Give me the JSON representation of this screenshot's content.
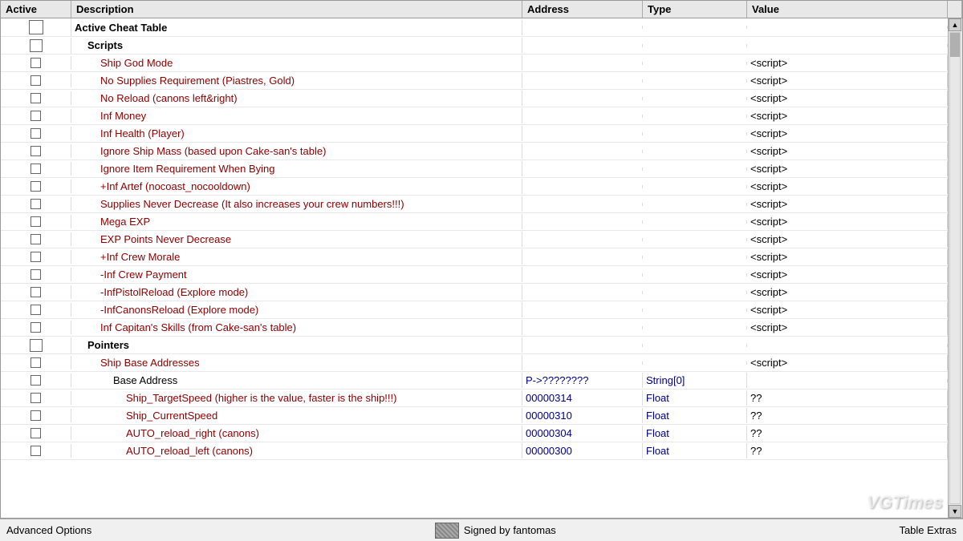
{
  "header": {
    "cols": [
      "Active",
      "Description",
      "Address",
      "Type",
      "Value"
    ]
  },
  "rows": [
    {
      "level": 0,
      "active": true,
      "desc": "Active Cheat Table",
      "address": "",
      "type": "",
      "value": "",
      "hasScript": false,
      "cbSize": "large"
    },
    {
      "level": 1,
      "active": true,
      "desc": "Scripts",
      "address": "",
      "type": "",
      "value": "",
      "hasScript": false,
      "cbSize": "medium"
    },
    {
      "level": 2,
      "active": false,
      "desc": "Ship God Mode",
      "address": "",
      "type": "",
      "value": "<script>",
      "hasScript": true
    },
    {
      "level": 2,
      "active": false,
      "desc": "No Supplies Requirement (Piastres, Gold)",
      "address": "",
      "type": "",
      "value": "<script>",
      "hasScript": true
    },
    {
      "level": 2,
      "active": false,
      "desc": "No Reload (canons left&right)",
      "address": "",
      "type": "",
      "value": "<script>",
      "hasScript": true
    },
    {
      "level": 2,
      "active": false,
      "desc": "Inf Money",
      "address": "",
      "type": "",
      "value": "<script>",
      "hasScript": true
    },
    {
      "level": 2,
      "active": false,
      "desc": "Inf Health (Player)",
      "address": "",
      "type": "",
      "value": "<script>",
      "hasScript": true
    },
    {
      "level": 2,
      "active": false,
      "desc": "Ignore Ship Mass  (based upon Cake-san's table)",
      "address": "",
      "type": "",
      "value": "<script>",
      "hasScript": true
    },
    {
      "level": 2,
      "active": false,
      "desc": "Ignore Item Requirement When Bying",
      "address": "",
      "type": "",
      "value": "<script>",
      "hasScript": true
    },
    {
      "level": 2,
      "active": false,
      "desc": "+Inf Artef (nocoast_nocooldown)",
      "address": "",
      "type": "",
      "value": "<script>",
      "hasScript": true
    },
    {
      "level": 2,
      "active": false,
      "desc": "Supplies Never Decrease (It also increases your crew numbers!!!)",
      "address": "",
      "type": "",
      "value": "<script>",
      "hasScript": true
    },
    {
      "level": 2,
      "active": false,
      "desc": "Mega EXP",
      "address": "",
      "type": "",
      "value": "<script>",
      "hasScript": true
    },
    {
      "level": 2,
      "active": false,
      "desc": "EXP Points Never Decrease",
      "address": "",
      "type": "",
      "value": "<script>",
      "hasScript": true
    },
    {
      "level": 2,
      "active": false,
      "desc": "+Inf Crew Morale",
      "address": "",
      "type": "",
      "value": "<script>",
      "hasScript": true
    },
    {
      "level": 2,
      "active": false,
      "desc": "-Inf Crew Payment",
      "address": "",
      "type": "",
      "value": "<script>",
      "hasScript": true
    },
    {
      "level": 2,
      "active": false,
      "desc": "-InfPistolReload (Explore mode)",
      "address": "",
      "type": "",
      "value": "<script>",
      "hasScript": true
    },
    {
      "level": 2,
      "active": false,
      "desc": "-InfCanonsReload (Explore mode)",
      "address": "",
      "type": "",
      "value": "<script>",
      "hasScript": true
    },
    {
      "level": 2,
      "active": false,
      "desc": "Inf Capitan's Skills (from Cake-san's table)",
      "address": "",
      "type": "",
      "value": "<script>",
      "hasScript": true
    },
    {
      "level": "pointers",
      "active": true,
      "desc": "Pointers",
      "address": "",
      "type": "",
      "value": "",
      "hasScript": false,
      "cbSize": "medium"
    },
    {
      "level": "ship-base",
      "active": false,
      "desc": "Ship Base Addresses",
      "address": "",
      "type": "",
      "value": "<script>",
      "hasScript": true
    },
    {
      "level": "base-addr",
      "active": false,
      "desc": "Base Address",
      "address": "P->????????",
      "type": "String[0]",
      "value": "",
      "hasScript": false
    },
    {
      "level": "pointer-child",
      "active": false,
      "desc": "Ship_TargetSpeed (higher is the value, faster is the ship!!!)",
      "address": "00000314",
      "type": "Float",
      "value": "??",
      "hasScript": false
    },
    {
      "level": "pointer-child",
      "active": false,
      "desc": "Ship_CurrentSpeed",
      "address": "00000310",
      "type": "Float",
      "value": "??",
      "hasScript": false
    },
    {
      "level": "pointer-child",
      "active": false,
      "desc": "AUTO_reload_right (canons)",
      "address": "00000304",
      "type": "Float",
      "value": "??",
      "hasScript": false
    },
    {
      "level": "pointer-child",
      "active": false,
      "desc": "AUTO_reload_left (canons)",
      "address": "00000300",
      "type": "Float",
      "value": "??",
      "hasScript": false
    }
  ],
  "statusbar": {
    "left": "Advanced Options",
    "center": "Signed by fantomas",
    "right": "Table Extras"
  },
  "watermark": "VGTimes"
}
